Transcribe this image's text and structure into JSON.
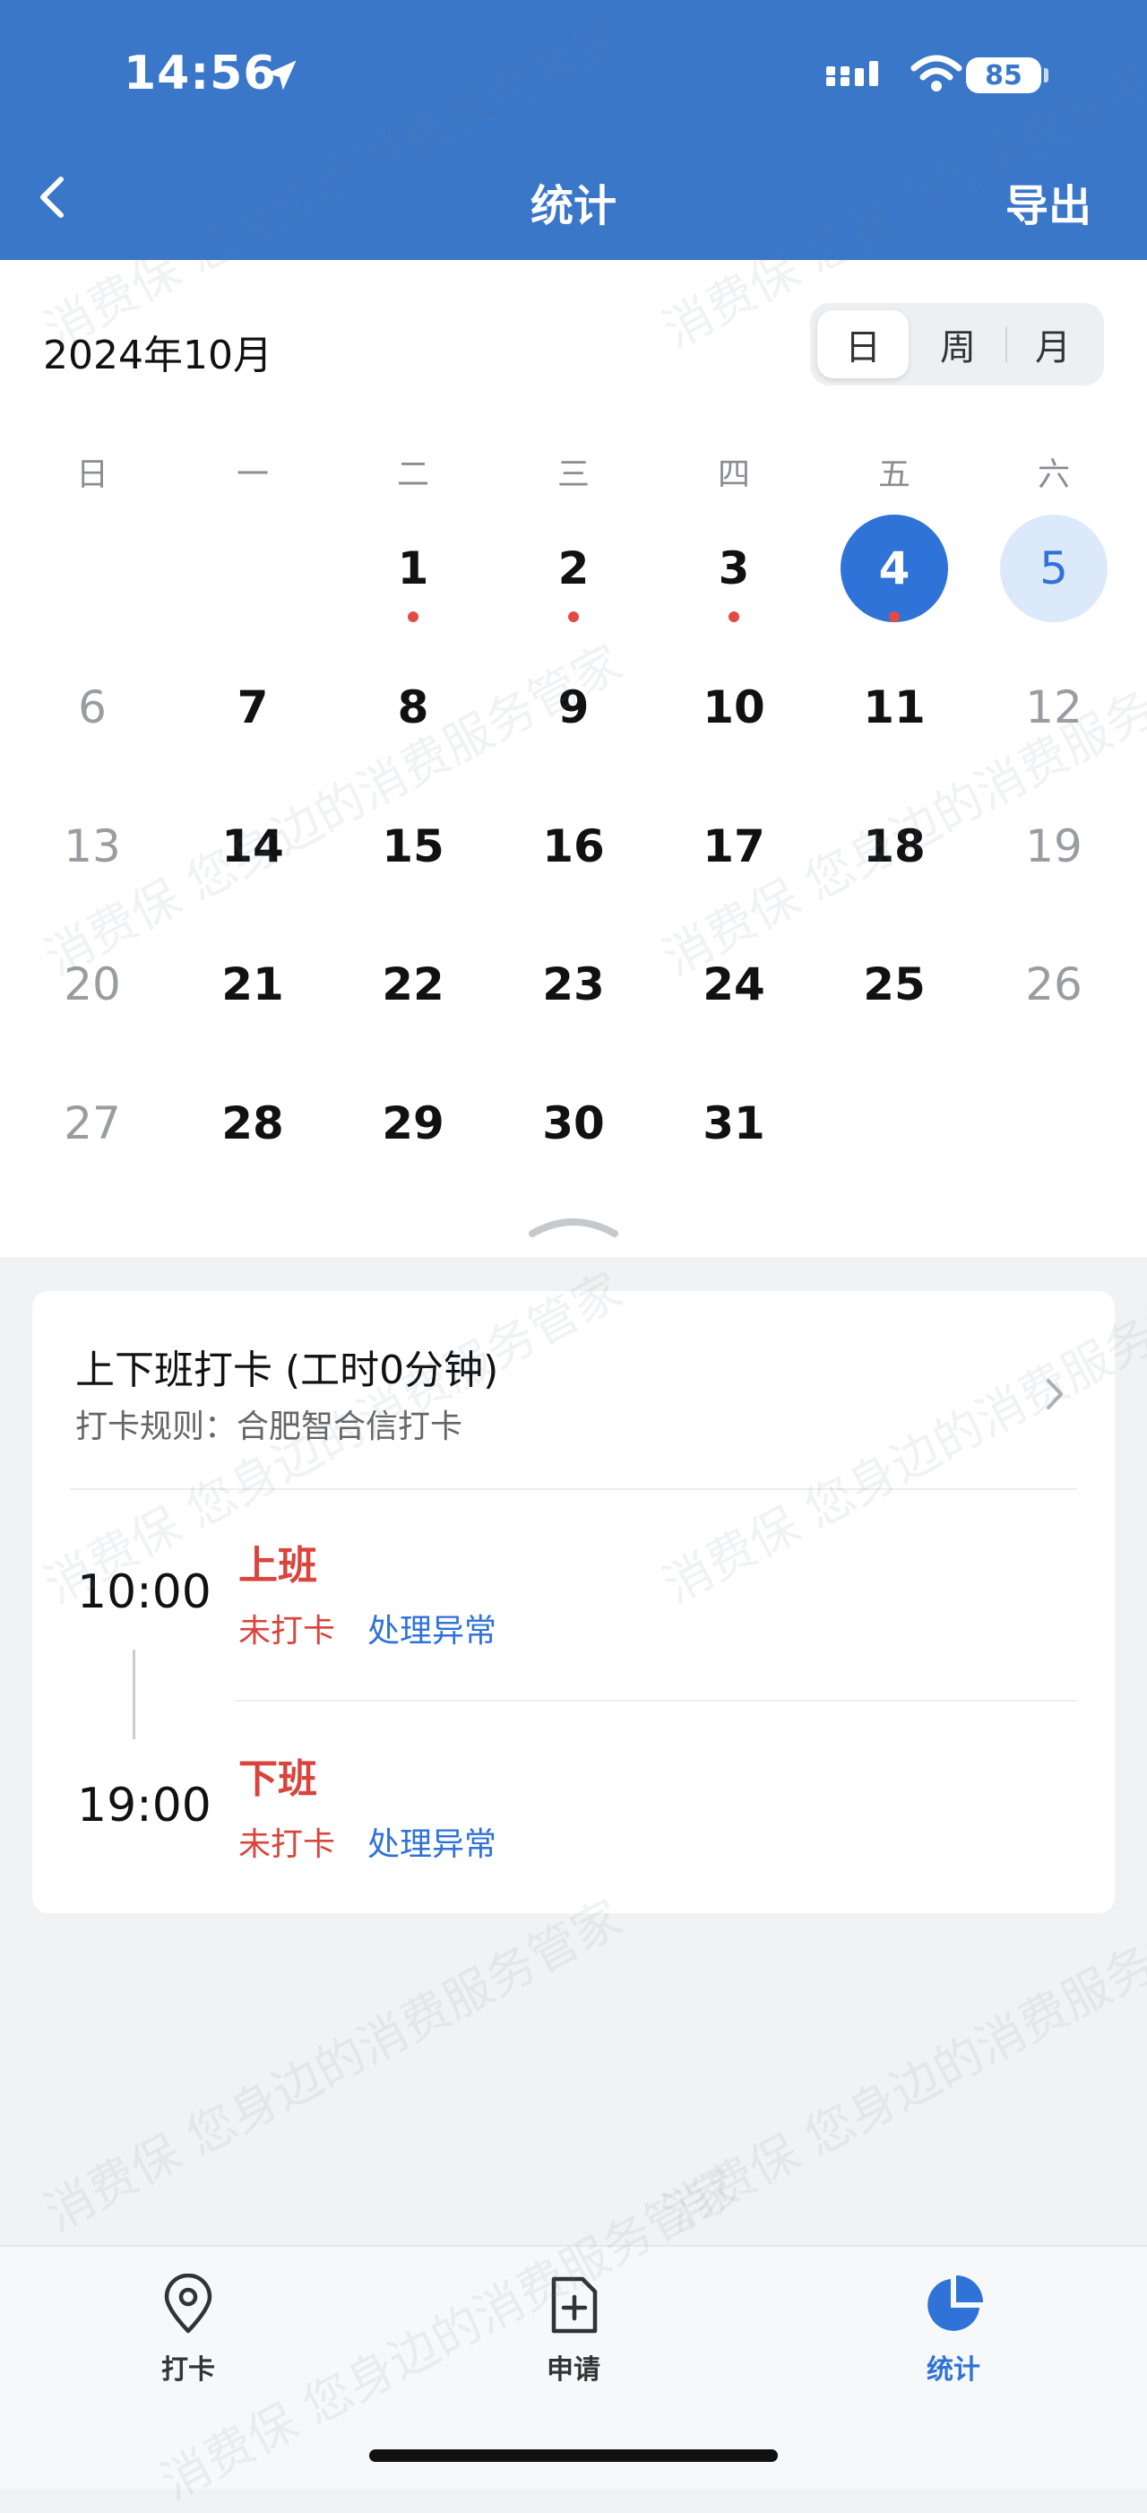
{
  "status_bar": {
    "time": "14:56",
    "battery": "85"
  },
  "nav": {
    "title": "统计",
    "export_label": "导出"
  },
  "calendar": {
    "month": "2024年10月",
    "view_modes": [
      "日",
      "周",
      "月"
    ],
    "active_view": "日",
    "weekdays": [
      "日",
      "一",
      "二",
      "三",
      "四",
      "五",
      "六"
    ],
    "days": [
      [
        "",
        "",
        "1",
        "2",
        "3",
        "4",
        "5"
      ],
      [
        "6",
        "7",
        "8",
        "9",
        "10",
        "11",
        "12"
      ],
      [
        "13",
        "14",
        "15",
        "16",
        "17",
        "18",
        "19"
      ],
      [
        "20",
        "21",
        "22",
        "23",
        "24",
        "25",
        "26"
      ],
      [
        "27",
        "28",
        "29",
        "30",
        "31",
        "",
        ""
      ]
    ],
    "selected_day": "4",
    "today": "5",
    "marked_days": [
      "1",
      "2",
      "3",
      "4"
    ]
  },
  "attendance": {
    "title": "上下班打卡 (工时0分钟)",
    "rule": "打卡规则：合肥智合信打卡",
    "entries": [
      {
        "time": "10:00",
        "label": "上班",
        "status": "未打卡",
        "action": "处理异常"
      },
      {
        "time": "19:00",
        "label": "下班",
        "status": "未打卡",
        "action": "处理异常"
      }
    ]
  },
  "tabs": [
    {
      "label": "打卡",
      "icon": "location-pin-icon"
    },
    {
      "label": "申请",
      "icon": "add-document-icon"
    },
    {
      "label": "统计",
      "icon": "pie-chart-icon"
    }
  ],
  "active_tab": "统计",
  "watermark": "消费保 您身边的消费服务管家",
  "colors": {
    "header": "#3a77c9",
    "accent": "#2f72d8",
    "alert": "#d9443c"
  }
}
